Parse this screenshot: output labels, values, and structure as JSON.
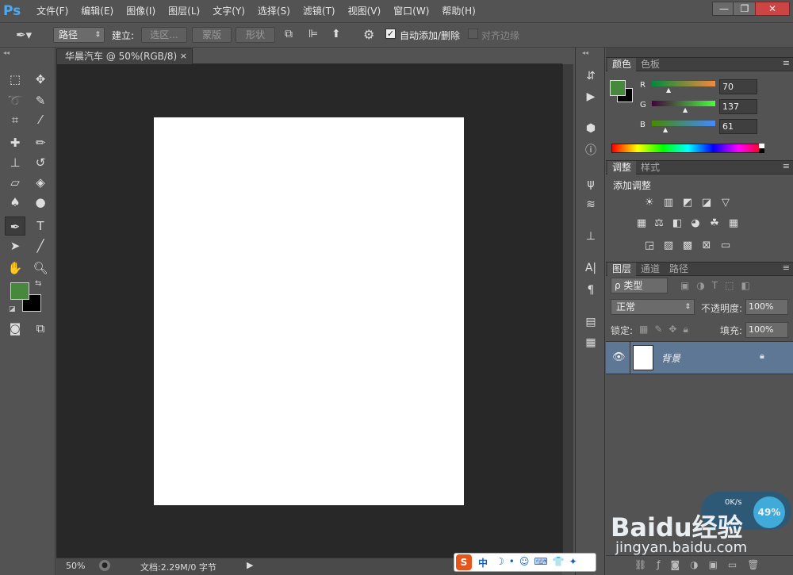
{
  "app": {
    "logo": "Ps"
  },
  "menu": [
    "文件(F)",
    "编辑(E)",
    "图像(I)",
    "图层(L)",
    "文字(Y)",
    "选择(S)",
    "滤镜(T)",
    "视图(V)",
    "窗口(W)",
    "帮助(H)"
  ],
  "window_controls": {
    "minimize": "—",
    "restore": "❐",
    "close": "✕"
  },
  "options": {
    "mode": "路径",
    "create_label": "建立:",
    "selection_btn": "选区...",
    "mask_btn": "蒙版",
    "shape_btn": "形状",
    "auto_add_delete": "自动添加/删除",
    "align_edges": "对齐边缘",
    "auto_checked": true,
    "align_checked": false
  },
  "document": {
    "tab_title": "华晨汽车 @ 50%(RGB/8)",
    "close": "×",
    "zoom": "50%",
    "status": "文档:2.29M/0 字节"
  },
  "colors": {
    "foreground": "#46893D",
    "background": "#000000",
    "canvas": "#FFFFFF"
  },
  "color_panel": {
    "tabs": [
      "颜色",
      "色板"
    ],
    "channels": [
      {
        "label": "R",
        "value": "70"
      },
      {
        "label": "G",
        "value": "137"
      },
      {
        "label": "B",
        "value": "61"
      }
    ]
  },
  "adjustments_panel": {
    "tabs": [
      "调整",
      "样式"
    ],
    "title": "添加调整"
  },
  "layers_panel": {
    "tabs": [
      "图层",
      "通道",
      "路径"
    ],
    "filter": "ρ 类型",
    "blend_mode": "正常",
    "opacity_label": "不透明度:",
    "opacity": "100%",
    "lock_label": "锁定:",
    "fill_label": "填充:",
    "fill": "100%",
    "layers": [
      {
        "name": "背景",
        "locked": true,
        "visible": true
      }
    ]
  },
  "taskbar": {
    "ime": "中",
    "speed": "0K/s",
    "percent": "49%"
  },
  "watermark": {
    "line1": "Baidu经验",
    "line2": "jingyan.baidu.com"
  }
}
